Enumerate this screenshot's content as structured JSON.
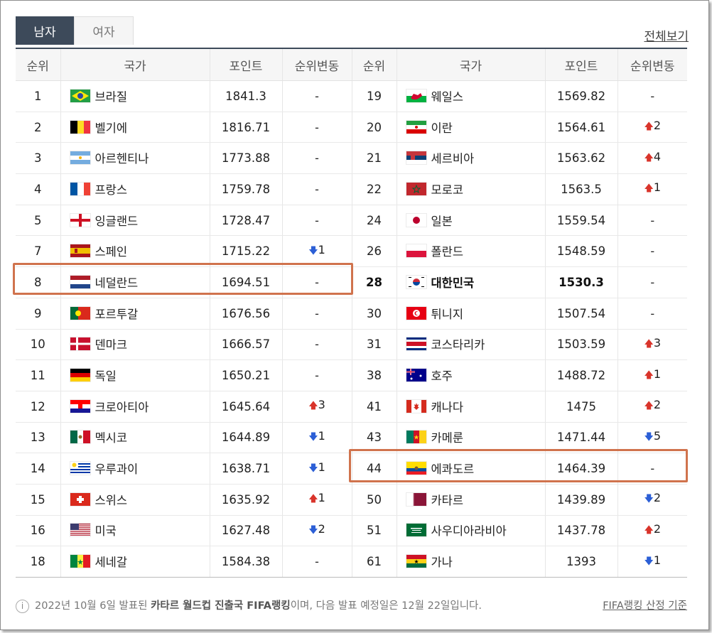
{
  "tabs": {
    "men": "남자",
    "women": "여자"
  },
  "full_view": "전체보기",
  "headers": {
    "rank": "순위",
    "country": "국가",
    "points": "포인트",
    "change": "순위변동"
  },
  "left": [
    {
      "rank": "1",
      "country": "브라질",
      "points": "1841.3",
      "arrow": "",
      "change": "-",
      "flag": "brazil"
    },
    {
      "rank": "2",
      "country": "벨기에",
      "points": "1816.71",
      "arrow": "",
      "change": "-",
      "flag": "belgium"
    },
    {
      "rank": "3",
      "country": "아르헨티나",
      "points": "1773.88",
      "arrow": "",
      "change": "-",
      "flag": "argentina"
    },
    {
      "rank": "4",
      "country": "프랑스",
      "points": "1759.78",
      "arrow": "",
      "change": "-",
      "flag": "france"
    },
    {
      "rank": "5",
      "country": "잉글랜드",
      "points": "1728.47",
      "arrow": "",
      "change": "-",
      "flag": "england"
    },
    {
      "rank": "7",
      "country": "스페인",
      "points": "1715.22",
      "arrow": "down",
      "change": "1",
      "flag": "spain"
    },
    {
      "rank": "8",
      "country": "네덜란드",
      "points": "1694.51",
      "arrow": "",
      "change": "-",
      "flag": "netherlands"
    },
    {
      "rank": "9",
      "country": "포르투갈",
      "points": "1676.56",
      "arrow": "",
      "change": "-",
      "flag": "portugal"
    },
    {
      "rank": "10",
      "country": "덴마크",
      "points": "1666.57",
      "arrow": "",
      "change": "-",
      "flag": "denmark"
    },
    {
      "rank": "11",
      "country": "독일",
      "points": "1650.21",
      "arrow": "",
      "change": "-",
      "flag": "germany"
    },
    {
      "rank": "12",
      "country": "크로아티아",
      "points": "1645.64",
      "arrow": "up",
      "change": "3",
      "flag": "croatia"
    },
    {
      "rank": "13",
      "country": "멕시코",
      "points": "1644.89",
      "arrow": "down",
      "change": "1",
      "flag": "mexico"
    },
    {
      "rank": "14",
      "country": "우루과이",
      "points": "1638.71",
      "arrow": "down",
      "change": "1",
      "flag": "uruguay"
    },
    {
      "rank": "15",
      "country": "스위스",
      "points": "1635.92",
      "arrow": "up",
      "change": "1",
      "flag": "switzerland"
    },
    {
      "rank": "16",
      "country": "미국",
      "points": "1627.48",
      "arrow": "down",
      "change": "2",
      "flag": "usa"
    },
    {
      "rank": "18",
      "country": "세네갈",
      "points": "1584.38",
      "arrow": "",
      "change": "-",
      "flag": "senegal"
    }
  ],
  "right": [
    {
      "rank": "19",
      "country": "웨일스",
      "points": "1569.82",
      "arrow": "",
      "change": "-",
      "flag": "wales"
    },
    {
      "rank": "20",
      "country": "이란",
      "points": "1564.61",
      "arrow": "up",
      "change": "2",
      "flag": "iran"
    },
    {
      "rank": "21",
      "country": "세르비아",
      "points": "1563.62",
      "arrow": "up",
      "change": "4",
      "flag": "serbia"
    },
    {
      "rank": "22",
      "country": "모로코",
      "points": "1563.5",
      "arrow": "up",
      "change": "1",
      "flag": "morocco"
    },
    {
      "rank": "24",
      "country": "일본",
      "points": "1559.54",
      "arrow": "",
      "change": "-",
      "flag": "japan"
    },
    {
      "rank": "26",
      "country": "폴란드",
      "points": "1548.59",
      "arrow": "",
      "change": "-",
      "flag": "poland"
    },
    {
      "rank": "28",
      "country": "대한민국",
      "points": "1530.3",
      "arrow": "",
      "change": "-",
      "flag": "korea"
    },
    {
      "rank": "30",
      "country": "튀니지",
      "points": "1507.54",
      "arrow": "",
      "change": "-",
      "flag": "tunisia"
    },
    {
      "rank": "31",
      "country": "코스타리카",
      "points": "1503.59",
      "arrow": "up",
      "change": "3",
      "flag": "costarica"
    },
    {
      "rank": "38",
      "country": "호주",
      "points": "1488.72",
      "arrow": "up",
      "change": "1",
      "flag": "australia"
    },
    {
      "rank": "41",
      "country": "캐나다",
      "points": "1475",
      "arrow": "up",
      "change": "2",
      "flag": "canada"
    },
    {
      "rank": "43",
      "country": "카메룬",
      "points": "1471.44",
      "arrow": "down",
      "change": "5",
      "flag": "cameroon"
    },
    {
      "rank": "44",
      "country": "에콰도르",
      "points": "1464.39",
      "arrow": "",
      "change": "-",
      "flag": "ecuador"
    },
    {
      "rank": "50",
      "country": "카타르",
      "points": "1439.89",
      "arrow": "down",
      "change": "2",
      "flag": "qatar"
    },
    {
      "rank": "51",
      "country": "사우디아라비아",
      "points": "1437.78",
      "arrow": "up",
      "change": "2",
      "flag": "saudi"
    },
    {
      "rank": "61",
      "country": "가나",
      "points": "1393",
      "arrow": "down",
      "change": "1",
      "flag": "ghana"
    }
  ],
  "footer": {
    "pre": "2022년 10월 6일 발표된 ",
    "bold": "카타르 월드컵 진출국 FIFA랭킹",
    "post": "이며, 다음 발표 예정일은 12월 22일입니다.",
    "criteria": "FIFA랭킹 산정 기준"
  },
  "colors": {
    "tab_active": "#3d4a5a",
    "highlight_box": "#d0734d",
    "up": "#d9342b",
    "down": "#2c5fd6"
  }
}
